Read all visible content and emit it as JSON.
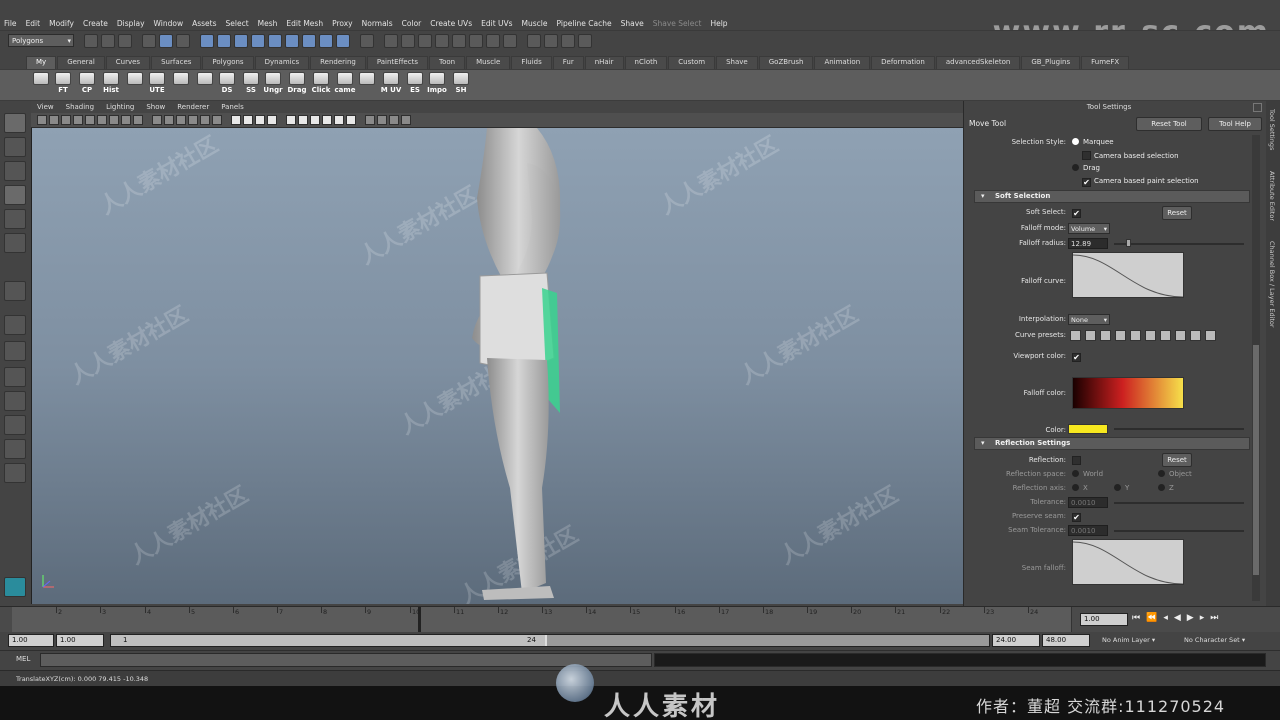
{
  "watermark_url": "www.rr-sc.com",
  "menus": [
    "File",
    "Edit",
    "Modify",
    "Create",
    "Display",
    "Window",
    "Assets",
    "Select",
    "Mesh",
    "Edit Mesh",
    "Proxy",
    "Normals",
    "Color",
    "Create UVs",
    "Edit UVs",
    "Muscle",
    "Pipeline Cache",
    "Shave",
    "Shave Select",
    "Help"
  ],
  "menu_disabled": [
    "Shave Select"
  ],
  "mode_select": "Polygons",
  "shelf_tabs": [
    "My",
    "General",
    "Curves",
    "Surfaces",
    "Polygons",
    "Dynamics",
    "Rendering",
    "PaintEffects",
    "Toon",
    "Muscle",
    "Fluids",
    "Fur",
    "nHair",
    "nCloth",
    "Custom",
    "Shave",
    "GoZBrush",
    "Animation",
    "Deformation",
    "advancedSkeleton",
    "GB_Plugins",
    "FumeFX"
  ],
  "shelf_active": "My",
  "shelf_buttons": [
    "",
    "FT",
    "CP",
    "Hist",
    "",
    "UTE",
    "",
    "",
    "DS",
    "SS",
    "Ungr",
    "Drag",
    "Click",
    "came",
    "",
    "M UV",
    "ES",
    "Impo",
    "SH"
  ],
  "panel_menu": [
    "View",
    "Shading",
    "Lighting",
    "Show",
    "Renderer",
    "Panels"
  ],
  "viewport_watermark": "人人素材社区",
  "tool_settings": {
    "panel_title": "Tool Settings",
    "tool_name": "Move Tool",
    "reset_button": "Reset Tool",
    "help_button": "Tool Help",
    "selection_style_label": "Selection Style:",
    "marquee": "Marquee",
    "camera_based_selection": "Camera based selection",
    "drag": "Drag",
    "camera_based_paint_selection": "Camera based paint selection",
    "soft_selection_header": "Soft Selection",
    "soft_select_label": "Soft Select:",
    "reset_label": "Reset",
    "falloff_mode_label": "Falloff mode:",
    "falloff_mode_value": "Volume",
    "falloff_radius_label": "Falloff radius:",
    "falloff_radius_value": "12.89",
    "falloff_curve_label": "Falloff curve:",
    "interpolation_label": "Interpolation:",
    "interpolation_value": "None",
    "curve_presets_label": "Curve presets:",
    "viewport_color_label": "Viewport color:",
    "falloff_color_label": "Falloff color:",
    "color_label": "Color:",
    "reflection_header": "Reflection Settings",
    "reflection_label": "Reflection:",
    "reflection_space_label": "Reflection space:",
    "world": "World",
    "object": "Object",
    "reflection_axis_label": "Reflection axis:",
    "axis_x": "X",
    "axis_y": "Y",
    "axis_z": "Z",
    "tolerance_label": "Tolerance:",
    "tolerance_value": "0.0010",
    "preserve_seam_label": "Preserve seam:",
    "seam_tolerance_label": "Seam Tolerance:",
    "seam_tolerance_value": "0.0010",
    "seam_falloff_label": "Seam falloff:"
  },
  "side_tabs": [
    "Tool Settings",
    "Attribute Editor",
    "Channel Box / Layer Editor"
  ],
  "timeline": {
    "ticks": [
      "2",
      "3",
      "4",
      "5",
      "6",
      "7",
      "8",
      "9",
      "10",
      "11",
      "12",
      "13",
      "14",
      "15",
      "16",
      "17",
      "18",
      "19",
      "20",
      "21",
      "22",
      "23",
      "24"
    ],
    "current_frame": "1.00"
  },
  "range": {
    "start": "1.00",
    "playback_start": "1.00",
    "slider_left": "1",
    "slider_right": "24",
    "playback_end": "24.00",
    "end": "48.00",
    "anim_layer": "No Anim Layer",
    "character_set": "No Character Set"
  },
  "command": {
    "label": "MEL"
  },
  "helpline": "TranslateXYZ(cm):    0.000      79.415     -10.348",
  "logo_text": "人人素材",
  "credit": "作者：董超    交流群:111270524"
}
